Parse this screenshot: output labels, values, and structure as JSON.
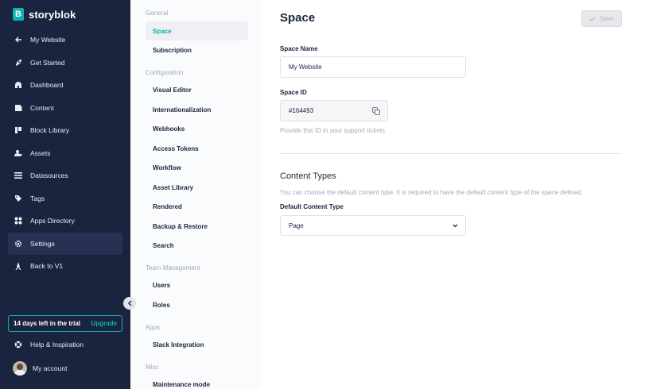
{
  "app": {
    "logo_letter": "B",
    "logo_text": "storyblok"
  },
  "sidebar": {
    "items": [
      {
        "label": "My Website",
        "icon": "arrow-left-icon"
      },
      {
        "label": "Get Started",
        "icon": "rocket-icon"
      },
      {
        "label": "Dashboard",
        "icon": "dashboard-icon"
      },
      {
        "label": "Content",
        "icon": "content-icon"
      },
      {
        "label": "Block Library",
        "icon": "block-library-icon"
      },
      {
        "label": "Assets",
        "icon": "assets-icon"
      },
      {
        "label": "Datasources",
        "icon": "datasources-icon"
      },
      {
        "label": "Tags",
        "icon": "tag-icon"
      },
      {
        "label": "Apps Directory",
        "icon": "apps-icon"
      },
      {
        "label": "Settings",
        "icon": "gear-icon",
        "active": true
      },
      {
        "label": "Back to V1",
        "icon": "back-v1-icon"
      }
    ],
    "trial_text": "14 days left in the trial",
    "upgrade_label": "Upgrade",
    "help_label": "Help & Inspiration",
    "account_label": "My account"
  },
  "subnav": {
    "general": "General",
    "space": "Space",
    "subscription": "Subscription",
    "configuration": "Configuration",
    "visual_editor": "Visual Editor",
    "internationalization": "Internationalization",
    "webhooks": "Webhooks",
    "access_tokens": "Access Tokens",
    "workflow": "Workflow",
    "asset_library": "Asset Library",
    "rendered": "Rendered",
    "backup_restore": "Backup & Restore",
    "search": "Search",
    "team_management": "Team Management",
    "users": "Users",
    "roles": "Roles",
    "apps": "Apps",
    "slack_integration": "Slack Integration",
    "misc": "Misc",
    "maintenance_mode": "Maintenance mode"
  },
  "main": {
    "title": "Space",
    "save_label": "Save",
    "space_name_label": "Space Name",
    "space_name_value": "My Website",
    "space_id_label": "Space ID",
    "space_id_value": "#164493",
    "space_id_help": "Provide this ID in your support tickets",
    "content_types_title": "Content Types",
    "content_types_help": "You can choose the default content type. It is required to have the default content type of the space defined.",
    "default_content_type_label": "Default Content Type",
    "default_content_type_value": "Page"
  },
  "colors": {
    "sidebar_bg": "#1b243f",
    "accent": "#09b3af",
    "subnav_bg": "#fafbfc"
  }
}
